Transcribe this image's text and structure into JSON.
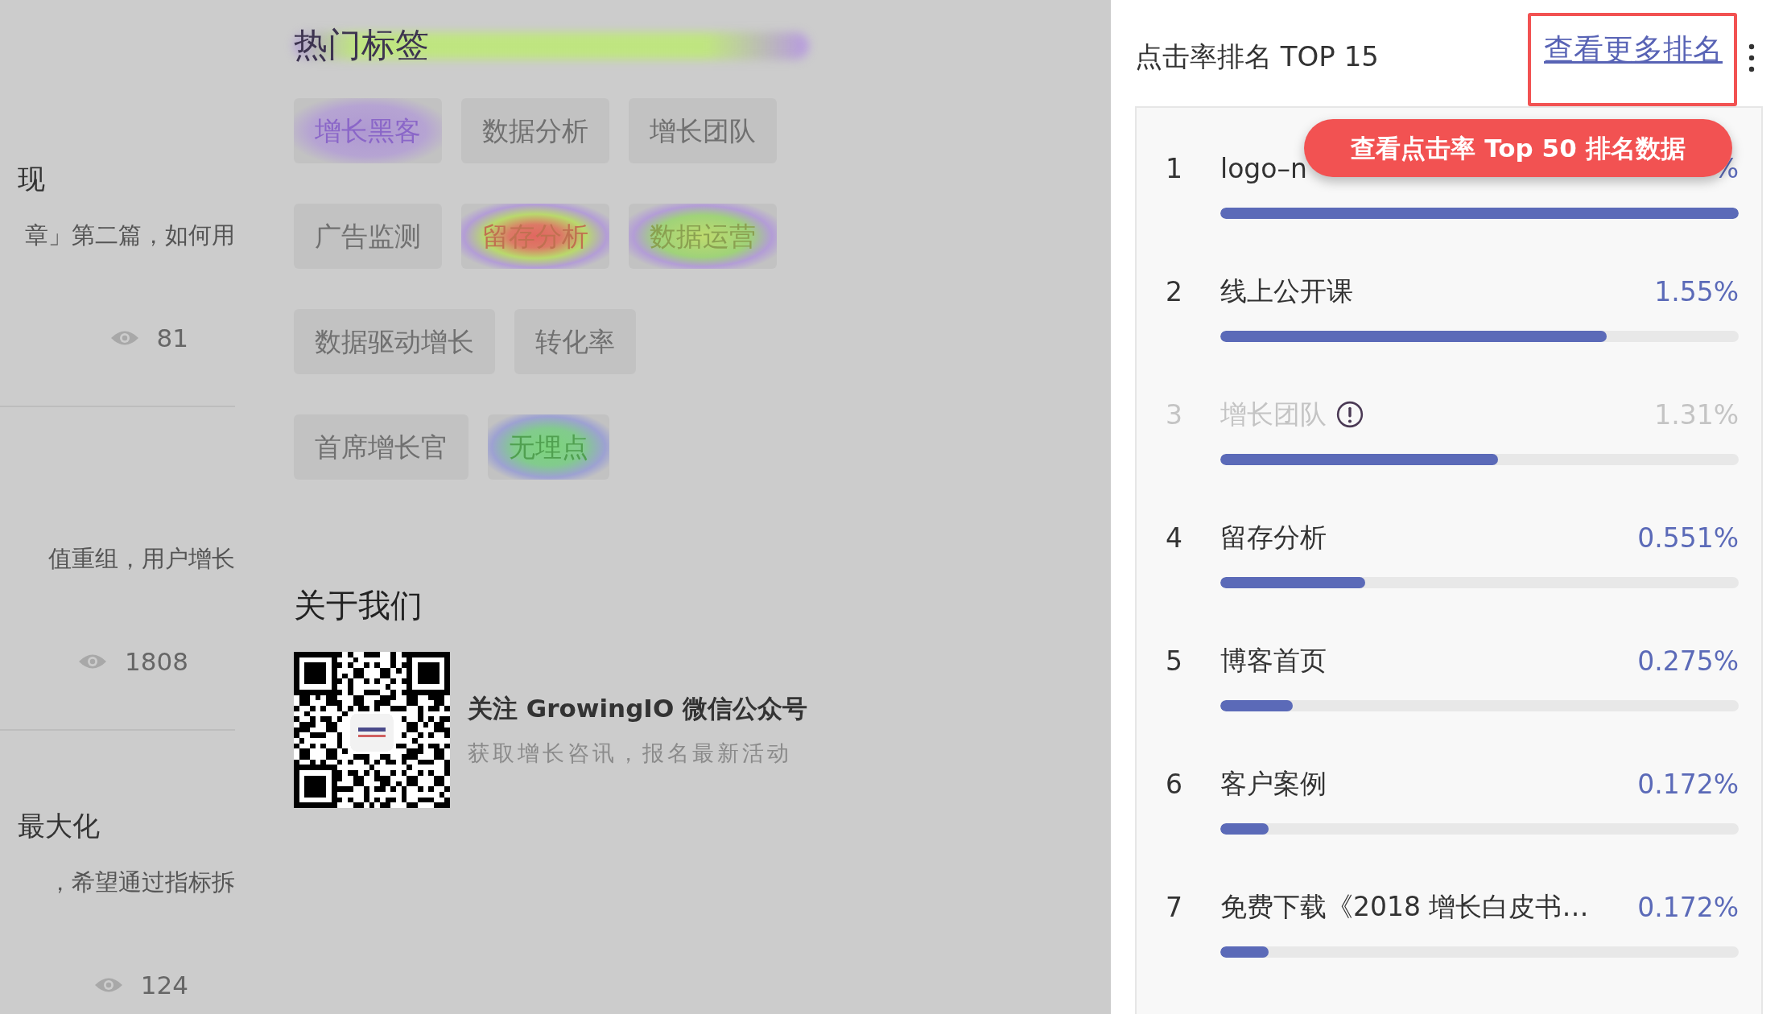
{
  "articles": [
    {
      "title": "现",
      "summary": "章」第二篇，如何用",
      "views": "81"
    },
    {
      "summary": "值重组，用户增长",
      "views": "1808"
    },
    {
      "title": "最大化",
      "summary": "，希望通过指标拆",
      "views": "124"
    }
  ],
  "hot_tags": {
    "title": "热门标签",
    "tags": [
      {
        "label": "增长黑客",
        "kind": "violet"
      },
      {
        "label": "数据分析",
        "kind": "none"
      },
      {
        "label": "增长团队",
        "kind": "none"
      },
      {
        "label": "广告监测",
        "kind": "none"
      },
      {
        "label": "留存分析",
        "kind": "hot"
      },
      {
        "label": "数据运营",
        "kind": "warm"
      },
      {
        "label": "数据驱动增长",
        "kind": "none"
      },
      {
        "label": "转化率",
        "kind": "none"
      },
      {
        "label": "首席增长官",
        "kind": "none"
      },
      {
        "label": "无埋点",
        "kind": "cool"
      }
    ]
  },
  "about": {
    "title": "关于我们",
    "follow": "关注 GrowingIO 微信公众号",
    "subtitle": "获取增长咨讯，报名最新活动"
  },
  "ranking": {
    "title": "点击率排名 TOP 15",
    "more_link": "查看更多排名",
    "tooltip": "查看点击率 Top 50 排名数据",
    "rows": [
      {
        "rank": "1",
        "name": "logo–n",
        "value": "%",
        "level": 1.0,
        "disabled": false,
        "warning": false
      },
      {
        "rank": "2",
        "name": "线上公开课",
        "value": "1.55%",
        "level": 0.745,
        "disabled": false,
        "warning": false
      },
      {
        "rank": "3",
        "name": "增长团队",
        "value": "1.31%",
        "level": 0.535,
        "disabled": true,
        "warning": true
      },
      {
        "rank": "4",
        "name": "留存分析",
        "value": "0.551%",
        "level": 0.28,
        "disabled": false,
        "warning": false
      },
      {
        "rank": "5",
        "name": "博客首页",
        "value": "0.275%",
        "level": 0.14,
        "disabled": false,
        "warning": false
      },
      {
        "rank": "6",
        "name": "客户案例",
        "value": "0.172%",
        "level": 0.093,
        "disabled": false,
        "warning": false
      },
      {
        "rank": "7",
        "name": "免费下载《2018 增长白皮书…",
        "value": "0.172%",
        "level": 0.093,
        "disabled": false,
        "warning": false
      }
    ]
  }
}
